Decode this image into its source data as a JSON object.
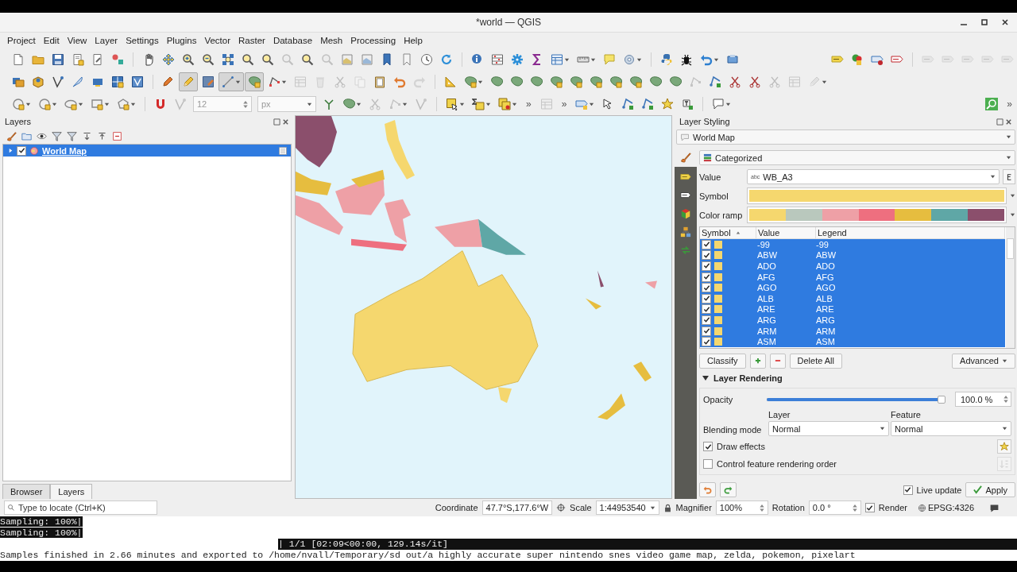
{
  "window": {
    "title": "*world — QGIS"
  },
  "menu": [
    {
      "label": "Project"
    },
    {
      "label": "Edit"
    },
    {
      "label": "View"
    },
    {
      "label": "Layer"
    },
    {
      "label": "Settings"
    },
    {
      "label": "Plugins"
    },
    {
      "label": "Vector"
    },
    {
      "label": "Raster"
    },
    {
      "label": "Database"
    },
    {
      "label": "Mesh"
    },
    {
      "label": "Processing"
    },
    {
      "label": "Help"
    }
  ],
  "toolbars": [
    [
      {
        "kind": "new",
        "disabled": false,
        "on": false,
        "menu": false
      },
      {
        "kind": "open",
        "disabled": false,
        "on": false,
        "menu": false
      },
      {
        "kind": "save",
        "disabled": false,
        "on": false,
        "menu": false
      },
      {
        "kind": "layout",
        "disabled": false,
        "on": false,
        "menu": false
      },
      {
        "kind": "docstyle",
        "disabled": false,
        "on": false,
        "menu": false
      },
      {
        "kind": "astyle",
        "disabled": false,
        "on": false,
        "menu": false
      },
      {
        "kind": "sep"
      },
      {
        "kind": "hand",
        "disabled": false,
        "on": false,
        "menu": false
      },
      {
        "kind": "pan",
        "disabled": false,
        "on": false,
        "menu": false
      },
      {
        "kind": "zoomin",
        "disabled": false,
        "on": false,
        "menu": false
      },
      {
        "kind": "zoomout",
        "disabled": false,
        "on": false,
        "menu": false
      },
      {
        "kind": "extent",
        "disabled": false,
        "on": false,
        "menu": false
      },
      {
        "kind": "mag",
        "disabled": false,
        "on": false,
        "menu": false
      },
      {
        "kind": "mag",
        "disabled": false,
        "on": false,
        "menu": false
      },
      {
        "kind": "mag",
        "disabled": true,
        "on": false,
        "menu": false
      },
      {
        "kind": "mag",
        "disabled": false,
        "on": false,
        "menu": false
      },
      {
        "kind": "mag",
        "disabled": true,
        "on": false,
        "menu": false
      },
      {
        "kind": "mapview",
        "disabled": false,
        "on": false,
        "menu": false
      },
      {
        "kind": "map3d",
        "disabled": false,
        "on": false,
        "menu": false
      },
      {
        "kind": "bookmark",
        "disabled": false,
        "on": false,
        "menu": false
      },
      {
        "kind": "bookmarks",
        "disabled": false,
        "on": false,
        "menu": false
      },
      {
        "kind": "clock",
        "disabled": false,
        "on": false,
        "menu": false
      },
      {
        "kind": "refresh",
        "disabled": false,
        "on": false,
        "menu": false
      },
      {
        "kind": "sep"
      },
      {
        "kind": "info",
        "disabled": false,
        "on": false,
        "menu": false
      },
      {
        "kind": "calc",
        "disabled": false,
        "on": false,
        "menu": false
      },
      {
        "kind": "gear",
        "disabled": false,
        "on": false,
        "menu": false
      },
      {
        "kind": "sum",
        "disabled": false,
        "on": false,
        "menu": false
      },
      {
        "kind": "table",
        "disabled": false,
        "on": false,
        "menu": true
      },
      {
        "kind": "measure",
        "disabled": false,
        "on": false,
        "menu": true
      },
      {
        "kind": "tip",
        "disabled": false,
        "on": false,
        "menu": false
      },
      {
        "kind": "identify",
        "disabled": false,
        "on": false,
        "menu": true
      },
      {
        "kind": "sep"
      },
      {
        "kind": "python",
        "disabled": false,
        "on": false,
        "menu": false
      },
      {
        "kind": "bug",
        "disabled": false,
        "on": false,
        "menu": false
      },
      {
        "kind": "undo",
        "disabled": false,
        "on": false,
        "menu": true
      },
      {
        "kind": "plugin",
        "disabled": false,
        "on": false,
        "menu": false
      },
      {
        "kind": "gap"
      },
      {
        "kind": "label",
        "disabled": false,
        "on": false,
        "menu": false
      },
      {
        "kind": "labelcolor",
        "disabled": false,
        "on": false,
        "menu": false
      },
      {
        "kind": "labelpin",
        "disabled": false,
        "on": false,
        "menu": false
      },
      {
        "kind": "labelred",
        "disabled": false,
        "on": false,
        "menu": false
      },
      {
        "kind": "sep"
      },
      {
        "kind": "label",
        "disabled": true,
        "on": false,
        "menu": false
      },
      {
        "kind": "label",
        "disabled": true,
        "on": false,
        "menu": false
      },
      {
        "kind": "label",
        "disabled": true,
        "on": false,
        "menu": false
      },
      {
        "kind": "label",
        "disabled": true,
        "on": false,
        "menu": false
      },
      {
        "kind": "label",
        "disabled": true,
        "on": false,
        "menu": false
      }
    ],
    [
      {
        "kind": "dsm",
        "disabled": false,
        "on": false,
        "menu": false
      },
      {
        "kind": "gpkg",
        "disabled": false,
        "on": false,
        "menu": false
      },
      {
        "kind": "digitize",
        "disabled": false,
        "on": false,
        "menu": false
      },
      {
        "kind": "feather",
        "disabled": false,
        "on": false,
        "menu": false
      },
      {
        "kind": "mesh",
        "disabled": false,
        "on": false,
        "menu": false
      },
      {
        "kind": "grid",
        "disabled": false,
        "on": false,
        "menu": false
      },
      {
        "kind": "vlayer",
        "disabled": false,
        "on": false,
        "menu": false
      },
      {
        "kind": "sep"
      },
      {
        "kind": "pencils",
        "disabled": false,
        "on": false,
        "menu": false
      },
      {
        "kind": "pencil",
        "disabled": false,
        "on": true,
        "menu": false
      },
      {
        "kind": "saveedit",
        "disabled": false,
        "on": false,
        "menu": false
      },
      {
        "kind": "line",
        "disabled": false,
        "on": true,
        "menu": true
      },
      {
        "kind": "polyadd",
        "disabled": false,
        "on": true,
        "menu": false
      },
      {
        "kind": "vertex",
        "disabled": false,
        "on": false,
        "menu": true
      },
      {
        "kind": "table",
        "disabled": true,
        "on": false,
        "menu": false
      },
      {
        "kind": "trash",
        "disabled": true,
        "on": false,
        "menu": false
      },
      {
        "kind": "cut",
        "disabled": true,
        "on": false,
        "menu": false
      },
      {
        "kind": "copy",
        "disabled": true,
        "on": false,
        "menu": false
      },
      {
        "kind": "paste",
        "disabled": false,
        "on": false,
        "menu": false
      },
      {
        "kind": "undo2",
        "disabled": false,
        "on": false,
        "menu": false
      },
      {
        "kind": "redo",
        "disabled": true,
        "on": false,
        "menu": false
      },
      {
        "kind": "sep"
      },
      {
        "kind": "setsquare",
        "disabled": false,
        "on": false,
        "menu": false
      },
      {
        "kind": "polyadd",
        "disabled": false,
        "on": false,
        "menu": true
      },
      {
        "kind": "polygon",
        "disabled": false,
        "on": false,
        "menu": false
      },
      {
        "kind": "polygon",
        "disabled": false,
        "on": false,
        "menu": false
      },
      {
        "kind": "polygon",
        "disabled": false,
        "on": false,
        "menu": false
      },
      {
        "kind": "polyadd",
        "disabled": false,
        "on": false,
        "menu": false
      },
      {
        "kind": "polyadd",
        "disabled": false,
        "on": false,
        "menu": false
      },
      {
        "kind": "polyadd",
        "disabled": false,
        "on": false,
        "menu": false
      },
      {
        "kind": "polyadd",
        "disabled": false,
        "on": false,
        "menu": false
      },
      {
        "kind": "polyadd",
        "disabled": false,
        "on": false,
        "menu": false
      },
      {
        "kind": "polygon",
        "disabled": false,
        "on": false,
        "menu": false
      },
      {
        "kind": "polygon",
        "disabled": false,
        "on": false,
        "menu": false
      },
      {
        "kind": "vertex",
        "disabled": true,
        "on": false,
        "menu": false
      },
      {
        "kind": "vertexadd",
        "disabled": false,
        "on": false,
        "menu": false
      },
      {
        "kind": "cut",
        "disabled": false,
        "on": false,
        "menu": false
      },
      {
        "kind": "cut",
        "disabled": false,
        "on": false,
        "menu": false
      },
      {
        "kind": "cut",
        "disabled": true,
        "on": false,
        "menu": false
      },
      {
        "kind": "table",
        "disabled": true,
        "on": false,
        "menu": false
      },
      {
        "kind": "pencil",
        "disabled": true,
        "on": false,
        "menu": true
      }
    ],
    [
      {
        "kind": "circle",
        "disabled": false,
        "on": false,
        "menu": true
      },
      {
        "kind": "circle",
        "disabled": false,
        "on": false,
        "menu": true
      },
      {
        "kind": "ellipse",
        "disabled": false,
        "on": false,
        "menu": true
      },
      {
        "kind": "rect",
        "disabled": false,
        "on": false,
        "menu": true
      },
      {
        "kind": "regpoly",
        "disabled": false,
        "on": false,
        "menu": true
      },
      {
        "kind": "sep"
      },
      {
        "kind": "magnet",
        "disabled": false,
        "on": false,
        "menu": false
      },
      {
        "kind": "digitize",
        "disabled": true,
        "on": false,
        "menu": false
      },
      {
        "kind": "field",
        "value": "12",
        "disabled": true
      },
      {
        "kind": "combo",
        "value": "px",
        "disabled": true
      },
      {
        "kind": "branch",
        "disabled": false,
        "on": false,
        "menu": false
      },
      {
        "kind": "polygon",
        "disabled": false,
        "on": false,
        "menu": true
      },
      {
        "kind": "cut",
        "disabled": true,
        "on": false,
        "menu": false
      },
      {
        "kind": "vertex",
        "disabled": true,
        "on": false,
        "menu": true
      },
      {
        "kind": "digitize",
        "disabled": true,
        "on": false,
        "menu": false
      },
      {
        "kind": "sep"
      },
      {
        "kind": "select",
        "disabled": false,
        "on": false,
        "menu": true
      },
      {
        "kind": "selexpr",
        "disabled": false,
        "on": false,
        "menu": true
      },
      {
        "kind": "selstack",
        "disabled": false,
        "on": false,
        "menu": true
      },
      {
        "kind": "more",
        "text": "»"
      },
      {
        "kind": "table",
        "disabled": true,
        "on": false,
        "menu": false
      },
      {
        "kind": "more",
        "text": "»"
      },
      {
        "kind": "labeltool",
        "disabled": false,
        "on": false,
        "menu": true
      },
      {
        "kind": "arrowsel",
        "disabled": false,
        "on": false,
        "menu": false
      },
      {
        "kind": "vertexadd",
        "disabled": false,
        "on": false,
        "menu": false
      },
      {
        "kind": "vertexadd",
        "disabled": false,
        "on": false,
        "menu": false
      },
      {
        "kind": "star",
        "disabled": false,
        "on": false,
        "menu": false
      },
      {
        "kind": "texttool",
        "disabled": false,
        "on": false,
        "menu": false
      },
      {
        "kind": "sep"
      },
      {
        "kind": "annotation",
        "disabled": false,
        "on": false,
        "menu": true
      },
      {
        "kind": "gap"
      },
      {
        "kind": "searchgreen",
        "disabled": false,
        "on": false,
        "menu": false
      },
      {
        "kind": "more",
        "text": "»"
      }
    ]
  ],
  "layers_panel": {
    "title": "Layers",
    "tree": [
      {
        "label": "World Map",
        "checked": true,
        "selected": true,
        "expanded": false
      }
    ],
    "tabs": [
      {
        "label": "Browser",
        "selected": false
      },
      {
        "label": "Layers",
        "selected": true
      }
    ]
  },
  "styling": {
    "title": "Layer Styling",
    "layer": "World Map",
    "side_tabs": [
      {
        "kind": "brush",
        "selected": true
      },
      {
        "kind": "label",
        "selected": false
      },
      {
        "kind": "labeloutline",
        "selected": false
      },
      {
        "kind": "cube",
        "selected": false
      },
      {
        "kind": "diagram",
        "selected": false
      },
      {
        "kind": "arrows",
        "selected": false
      }
    ],
    "renderer": "Categorized",
    "value_label": "Value",
    "value_type": "abc",
    "value": "WB_A3",
    "symbol_label": "Symbol",
    "ramp_label": "Color ramp",
    "ramp": [
      {
        "color": "#f5d76e"
      },
      {
        "color": "#b9c8bd"
      },
      {
        "color": "#eea0a6"
      },
      {
        "color": "#ee6f7f"
      },
      {
        "color": "#e6bd3f"
      },
      {
        "color": "#5fa7a6"
      },
      {
        "color": "#8b4f6c"
      }
    ],
    "columns": [
      {
        "label": "Symbol",
        "sorted": true
      },
      {
        "label": "Value",
        "sorted": false
      },
      {
        "label": "Legend",
        "sorted": false
      }
    ],
    "categories": [
      {
        "value": "-99",
        "legend": "-99",
        "checked": true,
        "selected": true
      },
      {
        "value": "ABW",
        "legend": "ABW",
        "checked": true,
        "selected": true
      },
      {
        "value": "ADO",
        "legend": "ADO",
        "checked": true,
        "selected": true
      },
      {
        "value": "AFG",
        "legend": "AFG",
        "checked": true,
        "selected": true
      },
      {
        "value": "AGO",
        "legend": "AGO",
        "checked": true,
        "selected": true
      },
      {
        "value": "ALB",
        "legend": "ALB",
        "checked": true,
        "selected": true
      },
      {
        "value": "ARE",
        "legend": "ARE",
        "checked": true,
        "selected": true
      },
      {
        "value": "ARG",
        "legend": "ARG",
        "checked": true,
        "selected": true
      },
      {
        "value": "ARM",
        "legend": "ARM",
        "checked": true,
        "selected": true
      },
      {
        "value": "ASM",
        "legend": "ASM",
        "checked": true,
        "selected": true
      }
    ],
    "classify": "Classify",
    "delete_all": "Delete All",
    "advanced": "Advanced",
    "rendering": {
      "title": "Layer Rendering",
      "expanded": true,
      "opacity_label": "Opacity",
      "opacity": {
        "level": 1.0,
        "reading": "100.0 %"
      },
      "blending_label": "Blending mode",
      "layer_label": "Layer",
      "layer_mode": "Normal",
      "feature_label": "Feature",
      "feature_mode": "Normal",
      "options": [
        {
          "label": "Draw effects",
          "checked": true
        },
        {
          "label": "Control feature rendering order",
          "checked": false
        }
      ]
    },
    "live_update": {
      "label": "Live update",
      "checked": true
    },
    "apply": "Apply"
  },
  "status_bar": {
    "locate_placeholder": "Type to locate (Ctrl+K)",
    "coordinate_label": "Coordinate",
    "coordinate": "47.7°S,177.6°W",
    "scale_label": "Scale",
    "scale": "1:44953540",
    "magnifier_label": "Magnifier",
    "magnifier": "100%",
    "rotation_label": "Rotation",
    "rotation": "0.0 °",
    "render": {
      "label": "Render",
      "checked": true
    },
    "crs": "EPSG:4326"
  },
  "terminal": {
    "lines": [
      {
        "kind": "plain",
        "text": "Sampling: 100%|",
        "highlighted": true
      },
      {
        "kind": "plain",
        "text": "Sampling: 100%|",
        "highlighted": true
      },
      {
        "kind": "progress",
        "text": "| 1/1 [02:09<00:00, 129.14s/it]",
        "highlighted": true
      },
      {
        "kind": "plain",
        "text": "Samples finished in 2.66 minutes and exported to /home/nvall/Temporary/sd out/a highly accurate super nintendo snes video game map, zelda, pokemon, pixelart",
        "highlighted": false
      }
    ]
  }
}
